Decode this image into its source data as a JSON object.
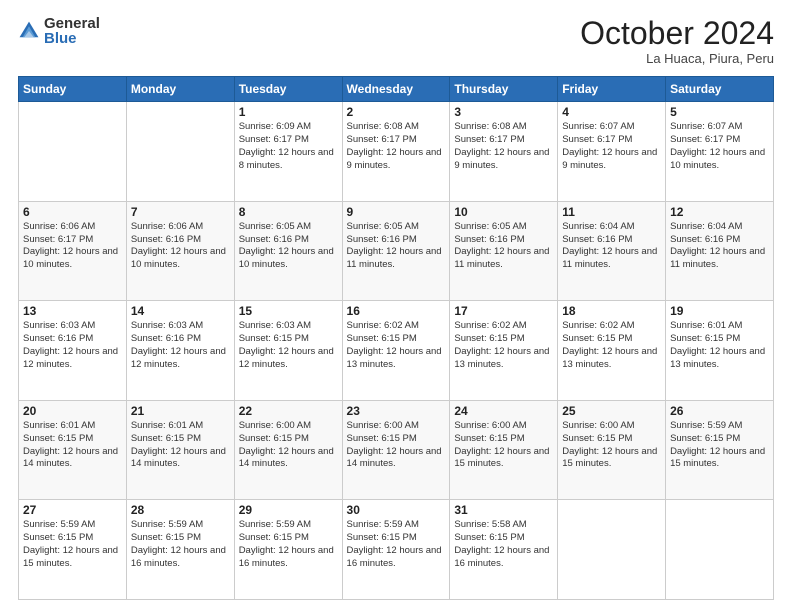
{
  "header": {
    "logo_general": "General",
    "logo_blue": "Blue",
    "title": "October 2024",
    "subtitle": "La Huaca, Piura, Peru"
  },
  "days_of_week": [
    "Sunday",
    "Monday",
    "Tuesday",
    "Wednesday",
    "Thursday",
    "Friday",
    "Saturday"
  ],
  "weeks": [
    [
      {
        "day": "",
        "info": ""
      },
      {
        "day": "",
        "info": ""
      },
      {
        "day": "1",
        "info": "Sunrise: 6:09 AM\nSunset: 6:17 PM\nDaylight: 12 hours and 8 minutes."
      },
      {
        "day": "2",
        "info": "Sunrise: 6:08 AM\nSunset: 6:17 PM\nDaylight: 12 hours and 9 minutes."
      },
      {
        "day": "3",
        "info": "Sunrise: 6:08 AM\nSunset: 6:17 PM\nDaylight: 12 hours and 9 minutes."
      },
      {
        "day": "4",
        "info": "Sunrise: 6:07 AM\nSunset: 6:17 PM\nDaylight: 12 hours and 9 minutes."
      },
      {
        "day": "5",
        "info": "Sunrise: 6:07 AM\nSunset: 6:17 PM\nDaylight: 12 hours and 10 minutes."
      }
    ],
    [
      {
        "day": "6",
        "info": "Sunrise: 6:06 AM\nSunset: 6:17 PM\nDaylight: 12 hours and 10 minutes."
      },
      {
        "day": "7",
        "info": "Sunrise: 6:06 AM\nSunset: 6:16 PM\nDaylight: 12 hours and 10 minutes."
      },
      {
        "day": "8",
        "info": "Sunrise: 6:05 AM\nSunset: 6:16 PM\nDaylight: 12 hours and 10 minutes."
      },
      {
        "day": "9",
        "info": "Sunrise: 6:05 AM\nSunset: 6:16 PM\nDaylight: 12 hours and 11 minutes."
      },
      {
        "day": "10",
        "info": "Sunrise: 6:05 AM\nSunset: 6:16 PM\nDaylight: 12 hours and 11 minutes."
      },
      {
        "day": "11",
        "info": "Sunrise: 6:04 AM\nSunset: 6:16 PM\nDaylight: 12 hours and 11 minutes."
      },
      {
        "day": "12",
        "info": "Sunrise: 6:04 AM\nSunset: 6:16 PM\nDaylight: 12 hours and 11 minutes."
      }
    ],
    [
      {
        "day": "13",
        "info": "Sunrise: 6:03 AM\nSunset: 6:16 PM\nDaylight: 12 hours and 12 minutes."
      },
      {
        "day": "14",
        "info": "Sunrise: 6:03 AM\nSunset: 6:16 PM\nDaylight: 12 hours and 12 minutes."
      },
      {
        "day": "15",
        "info": "Sunrise: 6:03 AM\nSunset: 6:15 PM\nDaylight: 12 hours and 12 minutes."
      },
      {
        "day": "16",
        "info": "Sunrise: 6:02 AM\nSunset: 6:15 PM\nDaylight: 12 hours and 13 minutes."
      },
      {
        "day": "17",
        "info": "Sunrise: 6:02 AM\nSunset: 6:15 PM\nDaylight: 12 hours and 13 minutes."
      },
      {
        "day": "18",
        "info": "Sunrise: 6:02 AM\nSunset: 6:15 PM\nDaylight: 12 hours and 13 minutes."
      },
      {
        "day": "19",
        "info": "Sunrise: 6:01 AM\nSunset: 6:15 PM\nDaylight: 12 hours and 13 minutes."
      }
    ],
    [
      {
        "day": "20",
        "info": "Sunrise: 6:01 AM\nSunset: 6:15 PM\nDaylight: 12 hours and 14 minutes."
      },
      {
        "day": "21",
        "info": "Sunrise: 6:01 AM\nSunset: 6:15 PM\nDaylight: 12 hours and 14 minutes."
      },
      {
        "day": "22",
        "info": "Sunrise: 6:00 AM\nSunset: 6:15 PM\nDaylight: 12 hours and 14 minutes."
      },
      {
        "day": "23",
        "info": "Sunrise: 6:00 AM\nSunset: 6:15 PM\nDaylight: 12 hours and 14 minutes."
      },
      {
        "day": "24",
        "info": "Sunrise: 6:00 AM\nSunset: 6:15 PM\nDaylight: 12 hours and 15 minutes."
      },
      {
        "day": "25",
        "info": "Sunrise: 6:00 AM\nSunset: 6:15 PM\nDaylight: 12 hours and 15 minutes."
      },
      {
        "day": "26",
        "info": "Sunrise: 5:59 AM\nSunset: 6:15 PM\nDaylight: 12 hours and 15 minutes."
      }
    ],
    [
      {
        "day": "27",
        "info": "Sunrise: 5:59 AM\nSunset: 6:15 PM\nDaylight: 12 hours and 15 minutes."
      },
      {
        "day": "28",
        "info": "Sunrise: 5:59 AM\nSunset: 6:15 PM\nDaylight: 12 hours and 16 minutes."
      },
      {
        "day": "29",
        "info": "Sunrise: 5:59 AM\nSunset: 6:15 PM\nDaylight: 12 hours and 16 minutes."
      },
      {
        "day": "30",
        "info": "Sunrise: 5:59 AM\nSunset: 6:15 PM\nDaylight: 12 hours and 16 minutes."
      },
      {
        "day": "31",
        "info": "Sunrise: 5:58 AM\nSunset: 6:15 PM\nDaylight: 12 hours and 16 minutes."
      },
      {
        "day": "",
        "info": ""
      },
      {
        "day": "",
        "info": ""
      }
    ]
  ]
}
